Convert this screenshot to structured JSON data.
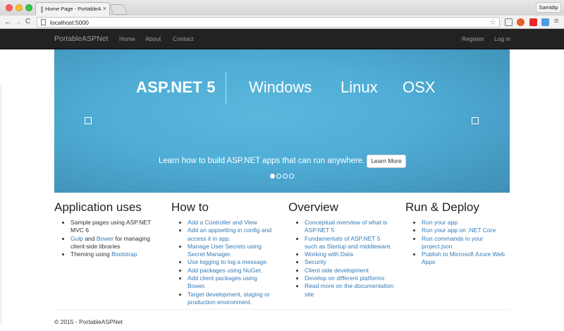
{
  "browser": {
    "tab_title": "Home Page - PortableASP",
    "tab_close": "×",
    "profile_name": "Samidip",
    "url": "localhost:5000",
    "back": "←",
    "forward": "→",
    "reload": "C",
    "star": "☆",
    "menu": "≡"
  },
  "navbar": {
    "brand": "PortableASPNet",
    "links": [
      "Home",
      "About",
      "Contact"
    ],
    "register": "Register",
    "login": "Log in"
  },
  "carousel": {
    "hero_bold": "ASP.NET 5",
    "hero_items": [
      "Windows",
      "Linux",
      "OSX"
    ],
    "caption": "Learn how to build ASP.NET apps that can run anywhere.",
    "button": "Learn More",
    "slide_count": 4,
    "active_slide": 1
  },
  "columns": [
    {
      "heading": "Application uses",
      "items": [
        {
          "parts": [
            {
              "text": "Sample pages using ASP.NET MVC 6",
              "link": false
            }
          ]
        },
        {
          "parts": [
            {
              "text": "Gulp",
              "link": true
            },
            {
              "text": " and ",
              "link": false
            },
            {
              "text": "Bower",
              "link": true
            },
            {
              "text": " for managing client-side libraries",
              "link": false
            }
          ]
        },
        {
          "parts": [
            {
              "text": "Theming using ",
              "link": false
            },
            {
              "text": "Bootstrap",
              "link": true
            }
          ]
        }
      ]
    },
    {
      "heading": "How to",
      "items": [
        {
          "parts": [
            {
              "text": "Add a Controller and View",
              "link": true
            }
          ]
        },
        {
          "parts": [
            {
              "text": "Add an appsetting in config and access it in app.",
              "link": true
            }
          ]
        },
        {
          "parts": [
            {
              "text": "Manage User Secrets using Secret Manager.",
              "link": true
            }
          ]
        },
        {
          "parts": [
            {
              "text": "Use logging to log a message.",
              "link": true
            }
          ]
        },
        {
          "parts": [
            {
              "text": "Add packages using NuGet.",
              "link": true
            }
          ]
        },
        {
          "parts": [
            {
              "text": "Add client packages using Bower.",
              "link": true
            }
          ]
        },
        {
          "parts": [
            {
              "text": "Target development, staging or production environment.",
              "link": true
            }
          ]
        }
      ]
    },
    {
      "heading": "Overview",
      "items": [
        {
          "parts": [
            {
              "text": "Conceptual overview of what is ASP.NET 5",
              "link": true
            }
          ]
        },
        {
          "parts": [
            {
              "text": "Fundamentals of ASP.NET 5 such as Startup and middleware.",
              "link": true
            }
          ]
        },
        {
          "parts": [
            {
              "text": "Working with Data",
              "link": true
            }
          ]
        },
        {
          "parts": [
            {
              "text": "Security",
              "link": true
            }
          ]
        },
        {
          "parts": [
            {
              "text": "Client side development",
              "link": true
            }
          ]
        },
        {
          "parts": [
            {
              "text": "Develop on different platforms",
              "link": true
            }
          ]
        },
        {
          "parts": [
            {
              "text": "Read more on the documentation site",
              "link": true
            }
          ]
        }
      ]
    },
    {
      "heading": "Run & Deploy",
      "items": [
        {
          "parts": [
            {
              "text": "Run your app",
              "link": true
            }
          ]
        },
        {
          "parts": [
            {
              "text": "Run your app on .NET Core",
              "link": true
            }
          ]
        },
        {
          "parts": [
            {
              "text": "Run commands in your project.json",
              "link": true
            }
          ]
        },
        {
          "parts": [
            {
              "text": "Publish to Microsoft Azure Web Apps",
              "link": true
            }
          ]
        }
      ]
    }
  ],
  "footer": "© 2015 - PortableASPNet",
  "colors": {
    "link": "#337ab7",
    "navbar_bg": "#222222",
    "navbar_text": "#9d9d9d",
    "carousel_bg": "#4fadd6"
  }
}
